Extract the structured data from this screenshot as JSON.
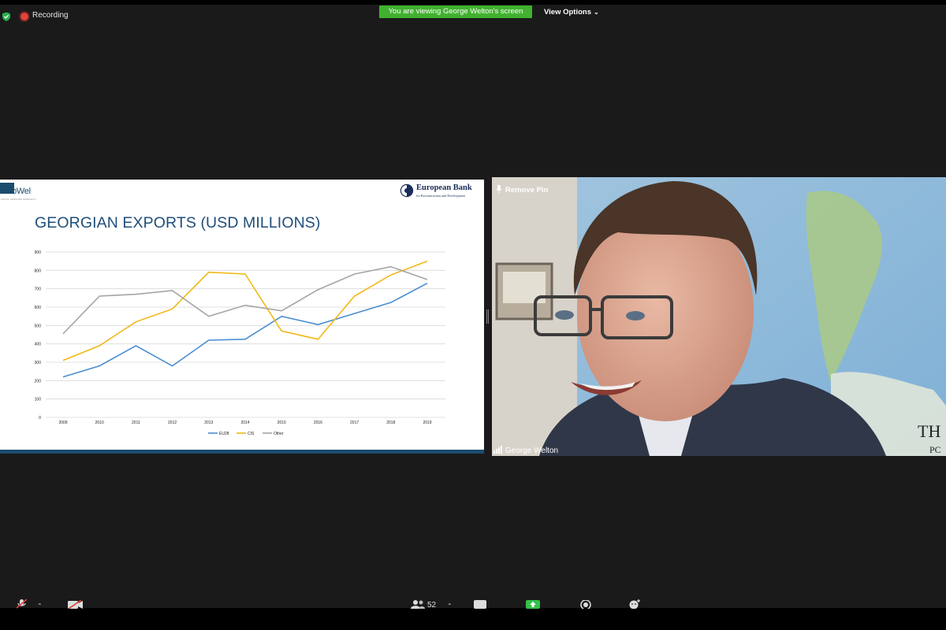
{
  "status_bar": {
    "recording_label": "Recording",
    "viewing_banner": "You are viewing George Welton's screen",
    "view_options_label": "View Options",
    "view_options_icon": "chevron-down-icon"
  },
  "shared_slide": {
    "logo_left_text": "GeoWel",
    "logo_left_subtitle": "SOCIAL ORIENTED RESEARCH",
    "logo_right_name": "European Bank",
    "logo_right_subtitle": "for Reconstruction and Development",
    "title": "GEORGIAN EXPORTS (USD MILLIONS)",
    "footer_color": "#1b4d6e"
  },
  "chart_data": {
    "type": "line",
    "title": "GEORGIAN EXPORTS (USD MILLIONS)",
    "x": [
      "2009",
      "2010",
      "2011",
      "2012",
      "2013",
      "2014",
      "2015",
      "2016",
      "2017",
      "2018",
      "2019"
    ],
    "ylim": [
      0,
      900
    ],
    "yticks": [
      0,
      100,
      200,
      300,
      400,
      500,
      600,
      700,
      800,
      900
    ],
    "grid": true,
    "legend_position": "bottom",
    "series": [
      {
        "name": "EU28",
        "color": "#4a8ed1",
        "values": [
          220,
          280,
          390,
          280,
          420,
          425,
          550,
          505,
          565,
          625,
          730
        ]
      },
      {
        "name": "CIS",
        "color": "#f2b816",
        "values": [
          310,
          390,
          520,
          590,
          790,
          780,
          470,
          425,
          660,
          775,
          850
        ]
      },
      {
        "name": "Other",
        "color": "#a5a5a5",
        "values": [
          455,
          660,
          670,
          690,
          550,
          610,
          580,
          695,
          780,
          820,
          750
        ]
      }
    ]
  },
  "video": {
    "remove_pin_label": "Remove Pin",
    "participant_name": "George Welton",
    "background_partial_text": [
      "TH",
      "PC"
    ]
  },
  "toolbar": {
    "participants_count": "52"
  }
}
